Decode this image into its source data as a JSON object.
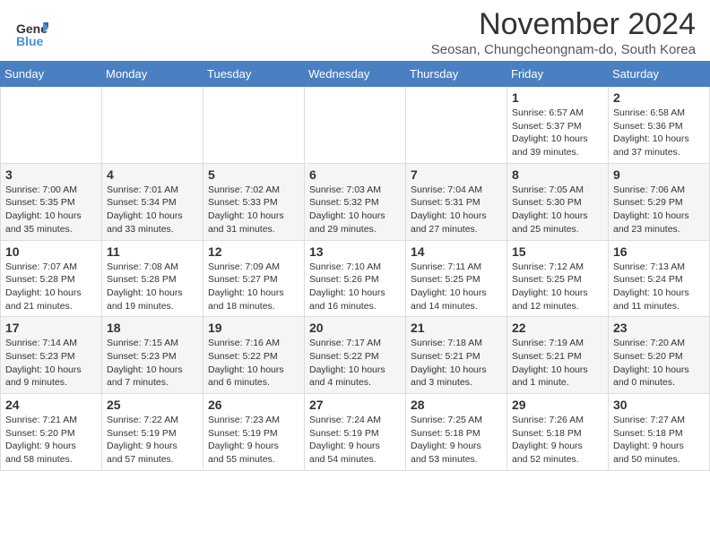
{
  "header": {
    "logo_line1": "General",
    "logo_line2": "Blue",
    "month_title": "November 2024",
    "location": "Seosan, Chungcheongnam-do, South Korea"
  },
  "weekdays": [
    "Sunday",
    "Monday",
    "Tuesday",
    "Wednesday",
    "Thursday",
    "Friday",
    "Saturday"
  ],
  "weeks": [
    [
      {
        "day": "",
        "info": ""
      },
      {
        "day": "",
        "info": ""
      },
      {
        "day": "",
        "info": ""
      },
      {
        "day": "",
        "info": ""
      },
      {
        "day": "",
        "info": ""
      },
      {
        "day": "1",
        "info": "Sunrise: 6:57 AM\nSunset: 5:37 PM\nDaylight: 10 hours\nand 39 minutes."
      },
      {
        "day": "2",
        "info": "Sunrise: 6:58 AM\nSunset: 5:36 PM\nDaylight: 10 hours\nand 37 minutes."
      }
    ],
    [
      {
        "day": "3",
        "info": "Sunrise: 7:00 AM\nSunset: 5:35 PM\nDaylight: 10 hours\nand 35 minutes."
      },
      {
        "day": "4",
        "info": "Sunrise: 7:01 AM\nSunset: 5:34 PM\nDaylight: 10 hours\nand 33 minutes."
      },
      {
        "day": "5",
        "info": "Sunrise: 7:02 AM\nSunset: 5:33 PM\nDaylight: 10 hours\nand 31 minutes."
      },
      {
        "day": "6",
        "info": "Sunrise: 7:03 AM\nSunset: 5:32 PM\nDaylight: 10 hours\nand 29 minutes."
      },
      {
        "day": "7",
        "info": "Sunrise: 7:04 AM\nSunset: 5:31 PM\nDaylight: 10 hours\nand 27 minutes."
      },
      {
        "day": "8",
        "info": "Sunrise: 7:05 AM\nSunset: 5:30 PM\nDaylight: 10 hours\nand 25 minutes."
      },
      {
        "day": "9",
        "info": "Sunrise: 7:06 AM\nSunset: 5:29 PM\nDaylight: 10 hours\nand 23 minutes."
      }
    ],
    [
      {
        "day": "10",
        "info": "Sunrise: 7:07 AM\nSunset: 5:28 PM\nDaylight: 10 hours\nand 21 minutes."
      },
      {
        "day": "11",
        "info": "Sunrise: 7:08 AM\nSunset: 5:28 PM\nDaylight: 10 hours\nand 19 minutes."
      },
      {
        "day": "12",
        "info": "Sunrise: 7:09 AM\nSunset: 5:27 PM\nDaylight: 10 hours\nand 18 minutes."
      },
      {
        "day": "13",
        "info": "Sunrise: 7:10 AM\nSunset: 5:26 PM\nDaylight: 10 hours\nand 16 minutes."
      },
      {
        "day": "14",
        "info": "Sunrise: 7:11 AM\nSunset: 5:25 PM\nDaylight: 10 hours\nand 14 minutes."
      },
      {
        "day": "15",
        "info": "Sunrise: 7:12 AM\nSunset: 5:25 PM\nDaylight: 10 hours\nand 12 minutes."
      },
      {
        "day": "16",
        "info": "Sunrise: 7:13 AM\nSunset: 5:24 PM\nDaylight: 10 hours\nand 11 minutes."
      }
    ],
    [
      {
        "day": "17",
        "info": "Sunrise: 7:14 AM\nSunset: 5:23 PM\nDaylight: 10 hours\nand 9 minutes."
      },
      {
        "day": "18",
        "info": "Sunrise: 7:15 AM\nSunset: 5:23 PM\nDaylight: 10 hours\nand 7 minutes."
      },
      {
        "day": "19",
        "info": "Sunrise: 7:16 AM\nSunset: 5:22 PM\nDaylight: 10 hours\nand 6 minutes."
      },
      {
        "day": "20",
        "info": "Sunrise: 7:17 AM\nSunset: 5:22 PM\nDaylight: 10 hours\nand 4 minutes."
      },
      {
        "day": "21",
        "info": "Sunrise: 7:18 AM\nSunset: 5:21 PM\nDaylight: 10 hours\nand 3 minutes."
      },
      {
        "day": "22",
        "info": "Sunrise: 7:19 AM\nSunset: 5:21 PM\nDaylight: 10 hours\nand 1 minute."
      },
      {
        "day": "23",
        "info": "Sunrise: 7:20 AM\nSunset: 5:20 PM\nDaylight: 10 hours\nand 0 minutes."
      }
    ],
    [
      {
        "day": "24",
        "info": "Sunrise: 7:21 AM\nSunset: 5:20 PM\nDaylight: 9 hours\nand 58 minutes."
      },
      {
        "day": "25",
        "info": "Sunrise: 7:22 AM\nSunset: 5:19 PM\nDaylight: 9 hours\nand 57 minutes."
      },
      {
        "day": "26",
        "info": "Sunrise: 7:23 AM\nSunset: 5:19 PM\nDaylight: 9 hours\nand 55 minutes."
      },
      {
        "day": "27",
        "info": "Sunrise: 7:24 AM\nSunset: 5:19 PM\nDaylight: 9 hours\nand 54 minutes."
      },
      {
        "day": "28",
        "info": "Sunrise: 7:25 AM\nSunset: 5:18 PM\nDaylight: 9 hours\nand 53 minutes."
      },
      {
        "day": "29",
        "info": "Sunrise: 7:26 AM\nSunset: 5:18 PM\nDaylight: 9 hours\nand 52 minutes."
      },
      {
        "day": "30",
        "info": "Sunrise: 7:27 AM\nSunset: 5:18 PM\nDaylight: 9 hours\nand 50 minutes."
      }
    ]
  ]
}
